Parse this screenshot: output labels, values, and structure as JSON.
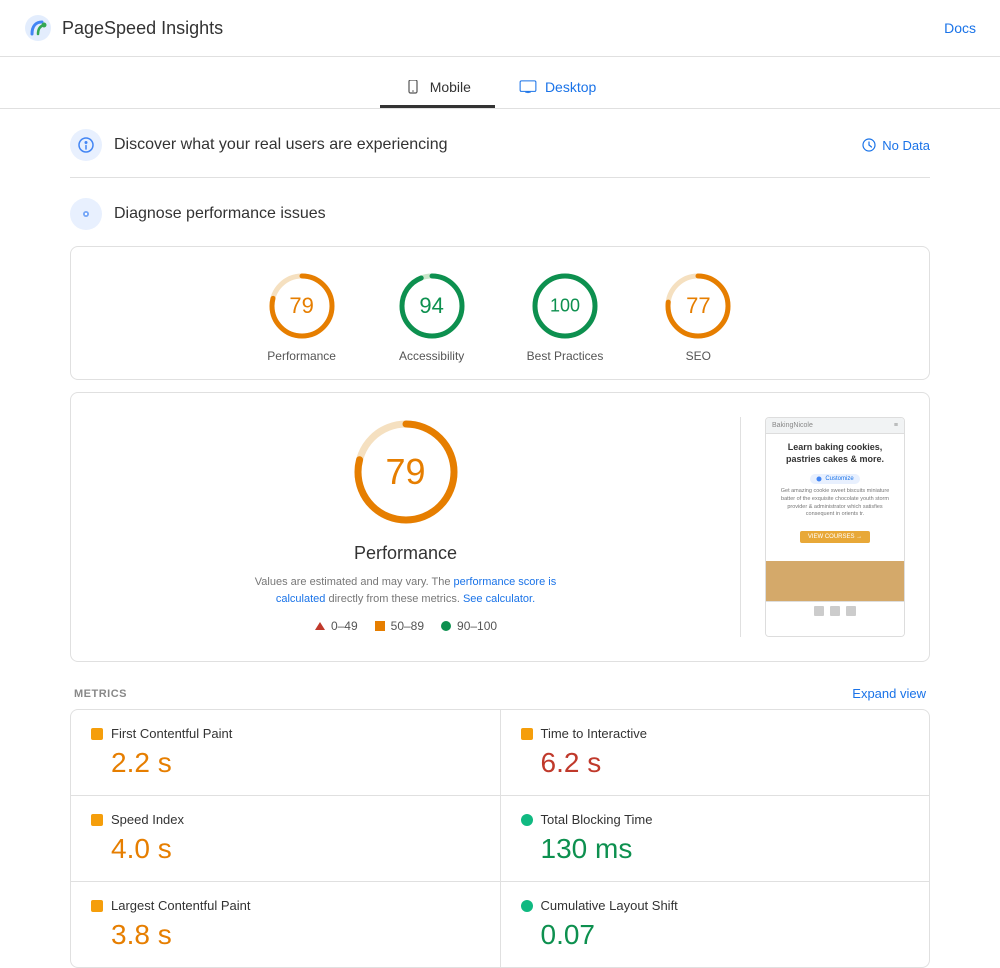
{
  "app": {
    "title": "PageSpeed Insights",
    "docs_label": "Docs"
  },
  "tabs": [
    {
      "id": "mobile",
      "label": "Mobile",
      "active": true
    },
    {
      "id": "desktop",
      "label": "Desktop",
      "active": false
    }
  ],
  "discover_section": {
    "title": "Discover what your real users are experiencing",
    "no_data_label": "No Data"
  },
  "diagnose_section": {
    "title": "Diagnose performance issues"
  },
  "scores": [
    {
      "id": "performance",
      "value": "79",
      "label": "Performance",
      "color": "#e67e00",
      "stroke_color": "#e67e00",
      "pct": 79
    },
    {
      "id": "accessibility",
      "value": "94",
      "label": "Accessibility",
      "color": "#0d904f",
      "stroke_color": "#0d904f",
      "pct": 94
    },
    {
      "id": "best-practices",
      "value": "100",
      "label": "Best Practices",
      "color": "#0d904f",
      "stroke_color": "#0d904f",
      "pct": 100
    },
    {
      "id": "seo",
      "value": "77",
      "label": "SEO",
      "color": "#e67e00",
      "stroke_color": "#e67e00",
      "pct": 77
    }
  ],
  "performance_detail": {
    "score": "79",
    "title": "Performance",
    "note_text": "Values are estimated and may vary. The",
    "note_link_text": "performance score is calculated",
    "note_link2": "directly from these metrics.",
    "note_link3": "See calculator.",
    "legend": [
      {
        "label": "0–49",
        "color": "#c0392b",
        "shape": "triangle"
      },
      {
        "label": "50–89",
        "color": "#e67e00",
        "shape": "square"
      },
      {
        "label": "90–100",
        "color": "#0d904f",
        "shape": "circle"
      }
    ]
  },
  "metrics": {
    "label": "METRICS",
    "expand_label": "Expand view",
    "items": [
      {
        "name": "First Contentful Paint",
        "value": "2.2 s",
        "color_class": "orange-dot",
        "value_class": "orange-val"
      },
      {
        "name": "Time to Interactive",
        "value": "6.2 s",
        "color_class": "orange-dot",
        "value_class": "red-val"
      },
      {
        "name": "Speed Index",
        "value": "4.0 s",
        "color_class": "orange-dot",
        "value_class": "orange-val"
      },
      {
        "name": "Total Blocking Time",
        "value": "130 ms",
        "color_class": "green-dot",
        "value_class": "green-val"
      },
      {
        "name": "Largest Contentful Paint",
        "value": "3.8 s",
        "color_class": "orange-dot",
        "value_class": "orange-val"
      },
      {
        "name": "Cumulative Layout Shift",
        "value": "0.07",
        "color_class": "green-dot",
        "value_class": "green-val"
      }
    ]
  },
  "preview": {
    "site_name": "BakingNicole",
    "headline": "Learn baking cookies, pastries cakes & more.",
    "body_text": "Get amazing cookie sweet biscuits miniature batter of the exquisite chocolate youth storm provider & administrator which satisfies consequent in orients tr.",
    "customize_label": "Customize",
    "cta_label": "VIEW COURSES →"
  }
}
